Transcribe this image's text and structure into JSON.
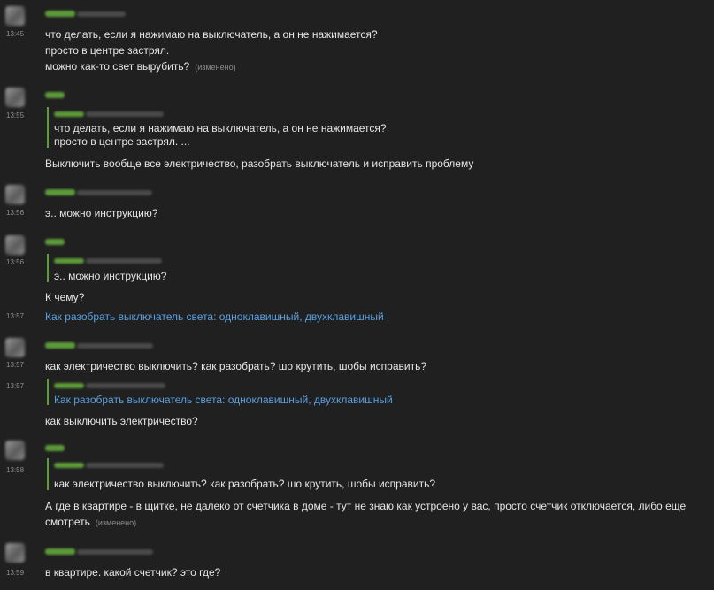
{
  "messages": [
    {
      "time": "13:45",
      "lines": [
        "что делать, если я нажимаю на выключатель, а он не нажимается?",
        "просто в центре застрял.",
        "можно как-то свет вырубить?"
      ],
      "edited": "(изменено)"
    },
    {
      "time": "13:55",
      "quote": [
        "что делать, если я нажимаю на выключатель, а он не нажимается?",
        "просто в центре застрял. ..."
      ],
      "text": "Выключить вообще все электричество, разобрать выключатель и исправить проблему"
    },
    {
      "time": "13:56",
      "text": "э.. можно инструкцию?"
    },
    {
      "time": "13:56",
      "quote": "э.. можно инструкцию?",
      "text": "К чему?"
    },
    {
      "time": "13:57",
      "link": "Как разобрать выключатель света: одноклавишный, двухклавишный"
    },
    {
      "time": "13:57",
      "text": "как электричество выключить? как разобрать? шо крутить, шобы исправить?"
    },
    {
      "time": "13:57",
      "quote": "Как разобрать выключатель света: одноклавишный, двухклавишный",
      "text": "как выключить электричество?"
    },
    {
      "time": "13:58",
      "quote": "как электричество выключить? как разобрать? шо крутить, шобы исправить?",
      "lines": [
        "А где в квартире - в щитке, не далеко от счетчика в доме - тут не знаю как устроено у вас, просто счетчик отключается, либо еще",
        "смотреть"
      ],
      "edited": "(изменено)"
    },
    {
      "time": "13:59",
      "text": "в квартире. какой счетчик? это где?"
    }
  ]
}
